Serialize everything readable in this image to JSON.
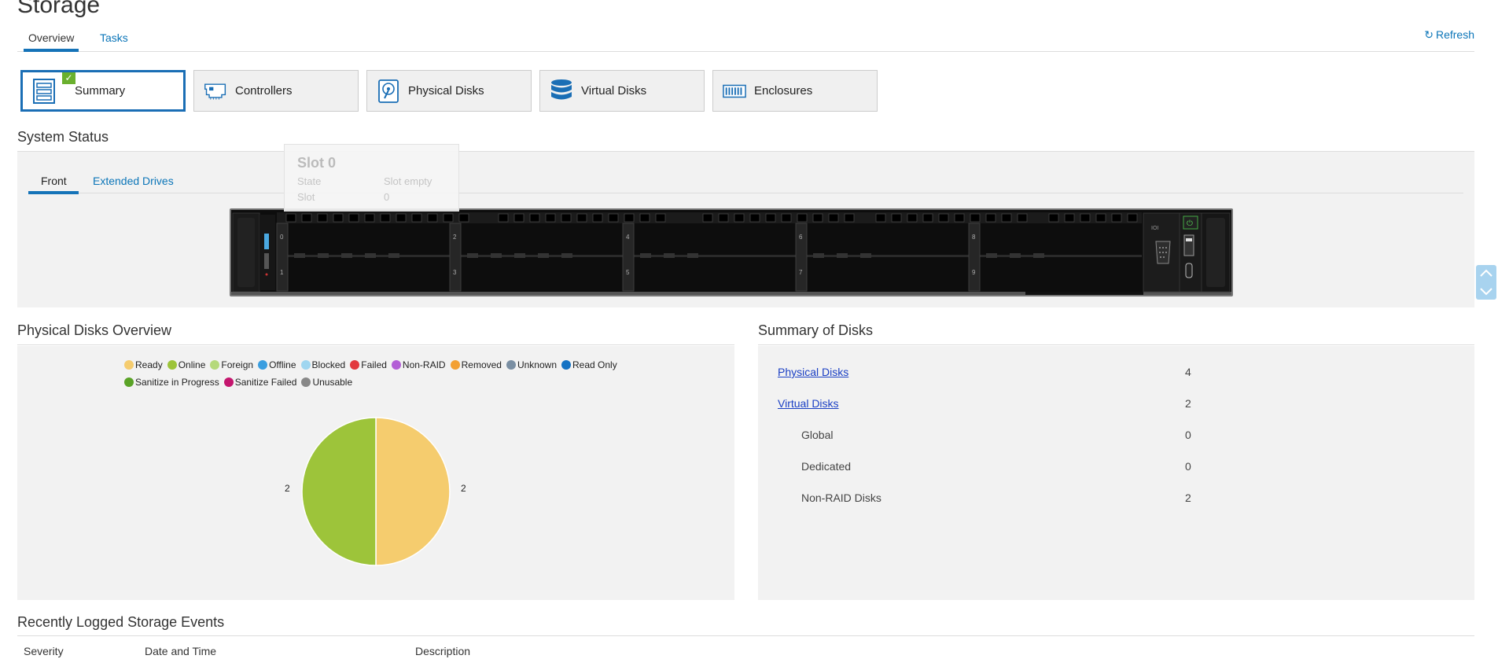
{
  "page": {
    "title": "Storage"
  },
  "top_tabs": [
    {
      "label": "Overview",
      "active": true
    },
    {
      "label": "Tasks",
      "active": false
    }
  ],
  "refresh_label": "Refresh",
  "categories": [
    {
      "label": "Summary",
      "icon": "summary-icon",
      "active": true
    },
    {
      "label": "Controllers",
      "icon": "controller-card-icon",
      "active": false
    },
    {
      "label": "Physical Disks",
      "icon": "physical-disk-icon",
      "active": false
    },
    {
      "label": "Virtual Disks",
      "icon": "virtual-disk-stack-icon",
      "active": false
    },
    {
      "label": "Enclosures",
      "icon": "enclosure-icon",
      "active": false
    }
  ],
  "system_status": {
    "title": "System Status",
    "tabs": [
      {
        "label": "Front",
        "active": true
      },
      {
        "label": "Extended Drives",
        "active": false
      }
    ],
    "tooltip": {
      "title": "Slot 0",
      "rows": [
        {
          "label": "State",
          "value": "Slot empty"
        },
        {
          "label": "Slot",
          "value": "0"
        }
      ]
    },
    "slot_labels": [
      "0",
      "1",
      "2",
      "3",
      "4",
      "5",
      "6",
      "7",
      "8",
      "9"
    ]
  },
  "physical_disks_overview": {
    "title": "Physical Disks Overview",
    "legend": [
      {
        "label": "Ready",
        "color": "#f5cc6e"
      },
      {
        "label": "Online",
        "color": "#9dc43a"
      },
      {
        "label": "Foreign",
        "color": "#b5d97a"
      },
      {
        "label": "Offline",
        "color": "#3a9ee0"
      },
      {
        "label": "Blocked",
        "color": "#9fd6f0"
      },
      {
        "label": "Failed",
        "color": "#e2393e"
      },
      {
        "label": "Non-RAID",
        "color": "#b35fd6"
      },
      {
        "label": "Removed",
        "color": "#f3a033"
      },
      {
        "label": "Unknown",
        "color": "#7a8fa3"
      },
      {
        "label": "Read Only",
        "color": "#1573c4"
      },
      {
        "label": "Sanitize in Progress",
        "color": "#5aa327"
      },
      {
        "label": "Sanitize Failed",
        "color": "#c4166e"
      },
      {
        "label": "Unusable",
        "color": "#888888"
      }
    ],
    "pie_labels": {
      "left": "2",
      "right": "2"
    }
  },
  "chart_data": {
    "type": "pie",
    "categories": [
      "Ready",
      "Online"
    ],
    "values": [
      2,
      2
    ],
    "colors": [
      "#f5cc6e",
      "#9dc43a"
    ]
  },
  "summary_of_disks": {
    "title": "Summary of Disks",
    "rows": [
      {
        "label": "Physical Disks",
        "value": "4",
        "link": true
      },
      {
        "label": "Virtual Disks",
        "value": "2",
        "link": true
      },
      {
        "label": "Global",
        "value": "0",
        "link": false
      },
      {
        "label": "Dedicated",
        "value": "0",
        "link": false
      },
      {
        "label": "Non-RAID Disks",
        "value": "2",
        "link": false
      }
    ]
  },
  "events": {
    "title": "Recently Logged Storage Events",
    "columns": [
      "Severity",
      "Date and Time",
      "Description"
    ]
  }
}
